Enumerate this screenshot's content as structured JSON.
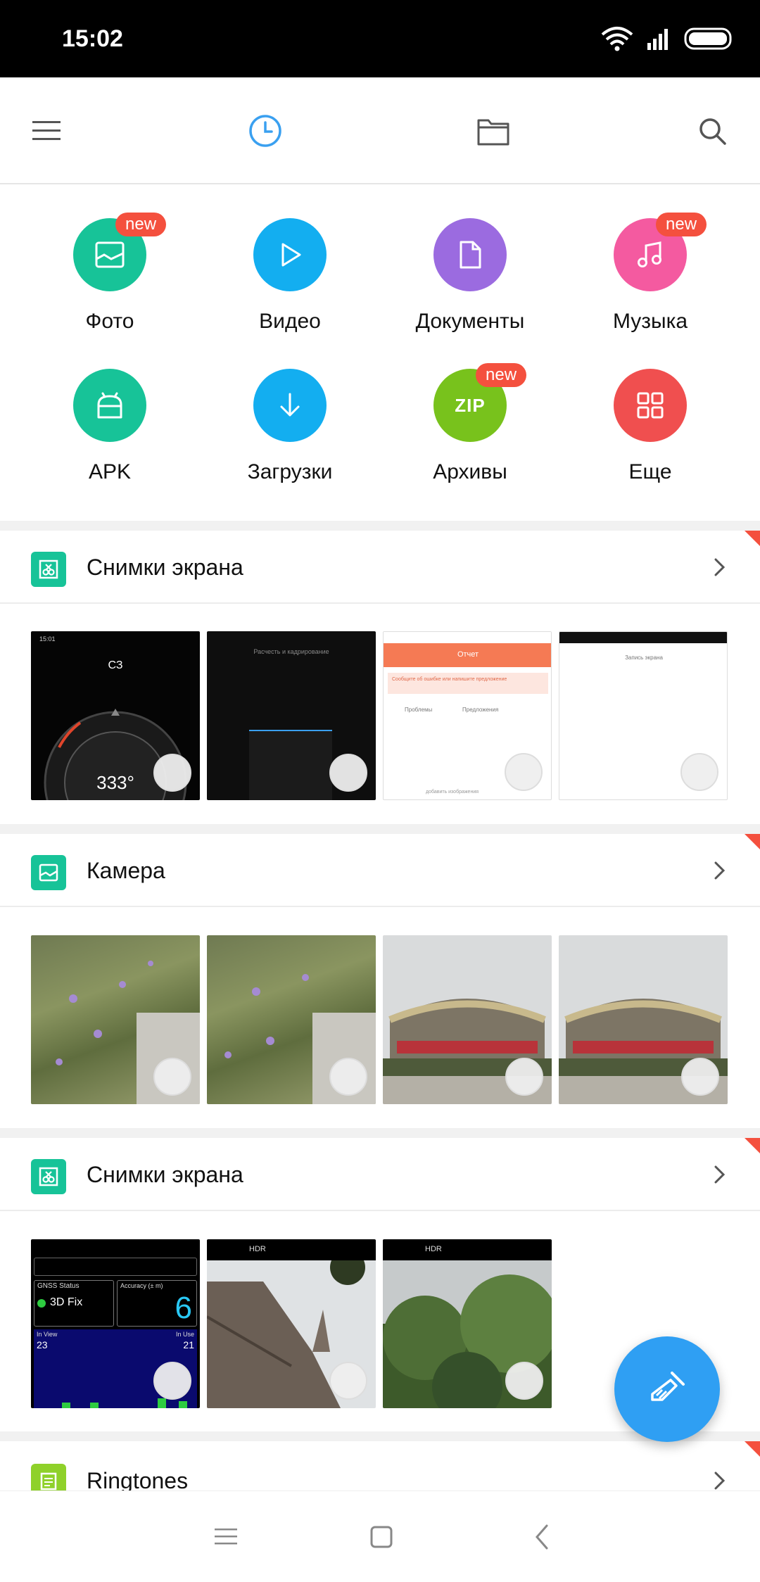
{
  "status_bar": {
    "time": "15:02"
  },
  "toolbar": {
    "menu_icon": "menu-icon",
    "recent_icon": "clock-icon",
    "folder_icon": "folder-icon",
    "search_icon": "search-icon",
    "accent": "#3aa0f0"
  },
  "categories": [
    {
      "label": "Фото",
      "color": "#17c398",
      "badge": "new",
      "icon": "image-icon"
    },
    {
      "label": "Видео",
      "color": "#13aef0",
      "badge": "",
      "icon": "play-icon"
    },
    {
      "label": "Документы",
      "color": "#9b6be0",
      "badge": "",
      "icon": "document-icon"
    },
    {
      "label": "Музыка",
      "color": "#f45aa0",
      "badge": "new",
      "icon": "music-note-icon"
    },
    {
      "label": "APK",
      "color": "#17c398",
      "badge": "",
      "icon": "android-icon"
    },
    {
      "label": "Загрузки",
      "color": "#13aef0",
      "badge": "",
      "icon": "download-icon"
    },
    {
      "label": "Архивы",
      "color": "#78c21c",
      "badge": "new",
      "icon_text": "ZIP"
    },
    {
      "label": "Еще",
      "color": "#f04f4f",
      "badge": "",
      "icon": "grid-icon"
    }
  ],
  "sections": [
    {
      "title": "Снимки экрана",
      "icon": "screenshot-icon",
      "icon_color": "#17c398"
    },
    {
      "title": "Камера",
      "icon": "image-icon",
      "icon_color": "#17c398"
    },
    {
      "title": "Снимки экрана",
      "icon": "screenshot-icon",
      "icon_color": "#17c398"
    },
    {
      "title": "Ringtones",
      "icon": "list-icon",
      "icon_color": "#8fd12a"
    }
  ],
  "thumbs": {
    "compass_heading": "СЗ",
    "compass_degrees": "333°",
    "dark_caption": "Расчесть и кадрирование",
    "report_title": "Отчет",
    "report_alert": "Сообщите об ошибке или напишите предложение",
    "report_opt1": "Проблемы",
    "report_opt2": "Предложения",
    "report_footer": "добавить изображения",
    "record_title": "Запись экрана",
    "gnss_status_label": "GNSS Status",
    "gnss_status_value": "3D Fix",
    "gnss_accuracy_label": "Accuracy (± m)",
    "gnss_accuracy_value": "6",
    "gnss_inview_label": "In View",
    "gnss_inview_value": "23",
    "gnss_inuse_label": "In Use",
    "gnss_inuse_value": "21",
    "cam_mode_hdr": "HDR"
  },
  "fab": {
    "icon": "broom-icon",
    "color": "#2f9ff3"
  },
  "navbar": {
    "recents_icon": "menu-icon",
    "home_icon": "square-icon",
    "back_icon": "back-icon"
  }
}
